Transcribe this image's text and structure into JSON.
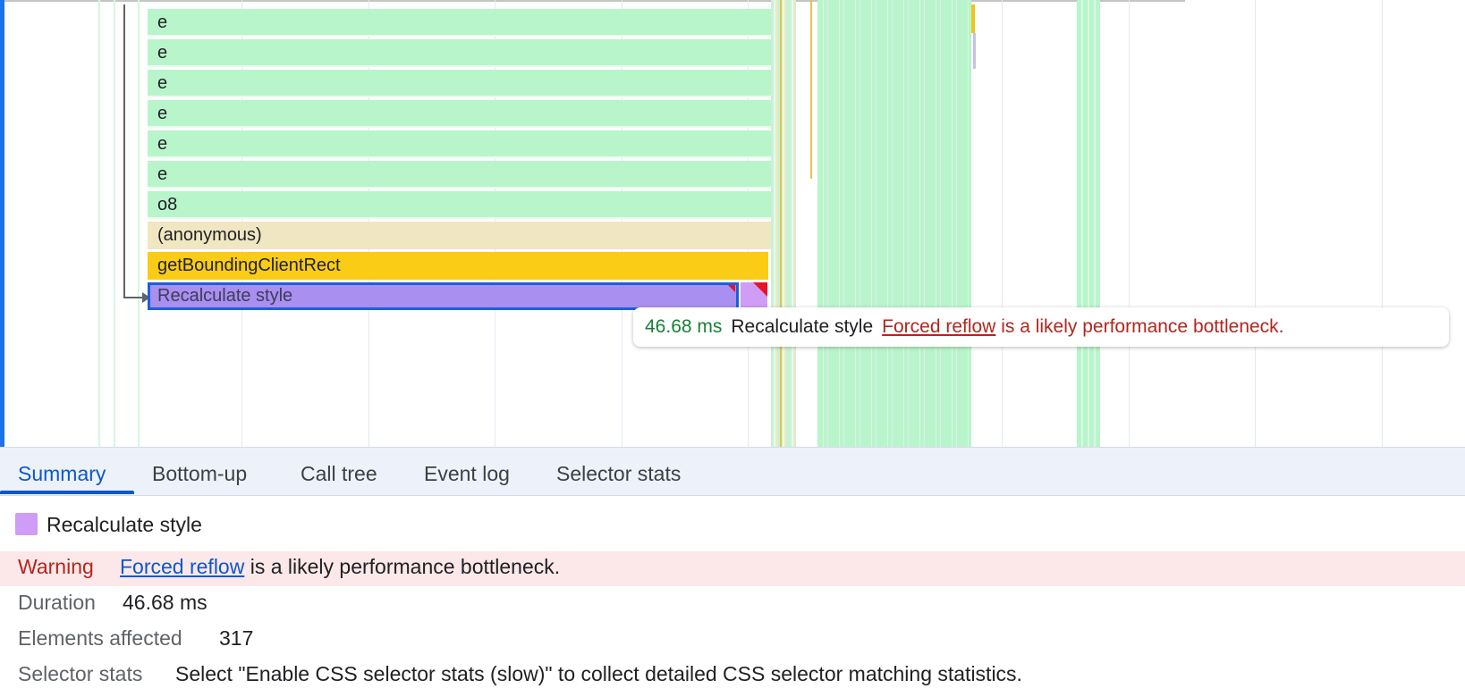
{
  "flame_chart": {
    "rows": [
      "e",
      "e",
      "e",
      "e",
      "e",
      "e",
      "o8",
      "(anonymous)",
      "getBoundingClientRect",
      "Recalculate style"
    ],
    "colors": {
      "script": "#b8f5ca",
      "anonymous": "#f1e6c2",
      "native": "#facc15",
      "rendering": "#a98ff0",
      "selection": "#1a5fdc",
      "warning_triangle": "#e8112d"
    }
  },
  "tooltip": {
    "duration": "46.68 ms",
    "name": "Recalculate style",
    "link": "Forced reflow",
    "message": "is a likely performance bottleneck."
  },
  "tabs": [
    {
      "label": "Summary",
      "active": true
    },
    {
      "label": "Bottom-up",
      "active": false
    },
    {
      "label": "Call tree",
      "active": false
    },
    {
      "label": "Event log",
      "active": false
    },
    {
      "label": "Selector stats",
      "active": false
    }
  ],
  "summary": {
    "title": "Recalculate style",
    "swatch_color": "#cf9cf6",
    "warning": {
      "label": "Warning",
      "link": "Forced reflow",
      "text": "is a likely performance bottleneck."
    },
    "duration_label": "Duration",
    "duration_value": "46.68 ms",
    "elements_label": "Elements affected",
    "elements_value": "317",
    "selector_stats_label": "Selector stats",
    "selector_stats_value": "Select \"Enable CSS selector stats (slow)\" to collect detailed CSS selector matching statistics."
  }
}
